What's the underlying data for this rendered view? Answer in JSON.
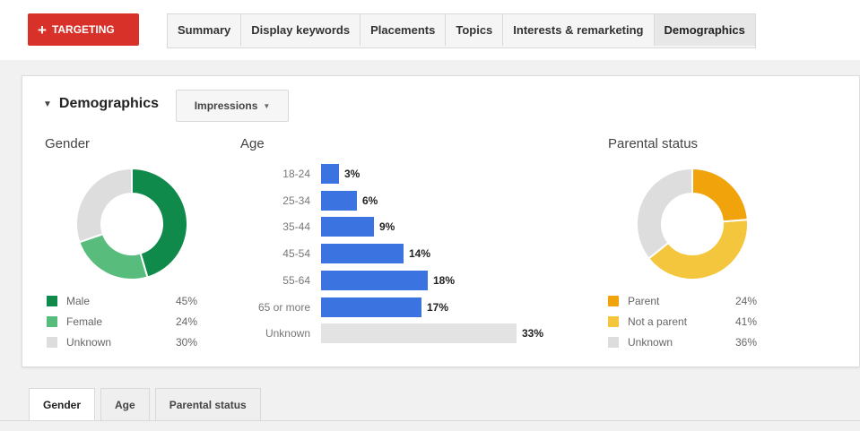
{
  "header": {
    "targeting_label": "TARGETING",
    "targeting_icon": "plus-icon",
    "tabs": [
      {
        "label": "Summary",
        "active": false
      },
      {
        "label": "Display keywords",
        "active": false
      },
      {
        "label": "Placements",
        "active": false
      },
      {
        "label": "Topics",
        "active": false
      },
      {
        "label": "Interests & remarketing",
        "active": false
      },
      {
        "label": "Demographics",
        "active": true
      }
    ]
  },
  "demographics": {
    "title": "Demographics",
    "metric_dropdown": "Impressions"
  },
  "gender": {
    "title": "Gender",
    "items": [
      {
        "label": "Male",
        "value": "45%",
        "color": "#0f8a4a"
      },
      {
        "label": "Female",
        "value": "24%",
        "color": "#58bd7c"
      },
      {
        "label": "Unknown",
        "value": "30%",
        "color": "#dddddd"
      }
    ]
  },
  "age": {
    "title": "Age",
    "rows": [
      {
        "label": "18-24",
        "value": "3%"
      },
      {
        "label": "25-34",
        "value": "6%"
      },
      {
        "label": "35-44",
        "value": "9%"
      },
      {
        "label": "45-54",
        "value": "14%"
      },
      {
        "label": "55-64",
        "value": "18%"
      },
      {
        "label": "65 or more",
        "value": "17%"
      },
      {
        "label": "Unknown",
        "value": "33%"
      }
    ],
    "bar_color": "#3b73e0",
    "unknown_color": "#e3e3e3"
  },
  "parental": {
    "title": "Parental status",
    "items": [
      {
        "label": "Parent",
        "value": "24%",
        "color": "#f0a30a"
      },
      {
        "label": "Not a parent",
        "value": "41%",
        "color": "#f4c63d"
      },
      {
        "label": "Unknown",
        "value": "36%",
        "color": "#dddddd"
      }
    ]
  },
  "bottom_tabs": [
    {
      "label": "Gender",
      "active": true
    },
    {
      "label": "Age",
      "active": false
    },
    {
      "label": "Parental status",
      "active": false
    }
  ]
}
